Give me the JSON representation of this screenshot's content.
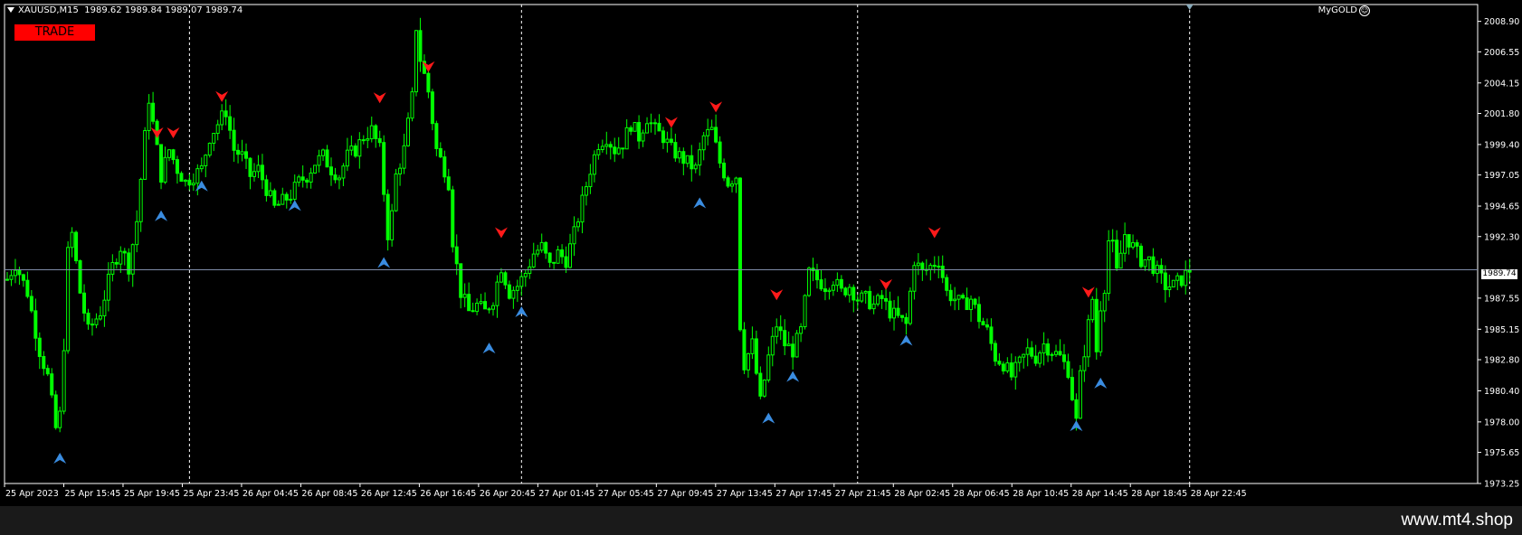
{
  "header": {
    "symbol_timeframe": "XAUUSD,M15",
    "ohlc": "1989.62 1989.84 1989.07 1989.74"
  },
  "trade_button": {
    "label": "TRADE"
  },
  "ea": {
    "name": "MyGOLD",
    "icon": "smiley-icon"
  },
  "footer": {
    "site": "www.mt4.shop"
  },
  "colors": {
    "bull": "#00ff00",
    "bear": "#00ff00",
    "sell_arrow": "#ff1a1a",
    "buy_arrow": "#3a8ce0",
    "grid": "#ffffff",
    "bid_line": "#7f8ca8",
    "background": "#000000"
  },
  "chart_data": {
    "type": "candlestick",
    "symbol": "XAUUSD",
    "timeframe": "M15",
    "current_price": "1989.74",
    "ylim": [
      1973.25,
      2010.2
    ],
    "price_ticks": [
      "2008.90",
      "2006.55",
      "2004.15",
      "2001.80",
      "1999.40",
      "1997.05",
      "1994.65",
      "1992.30",
      "1987.55",
      "1985.15",
      "1982.80",
      "1980.40",
      "1978.00",
      "1975.65",
      "1973.25"
    ],
    "time_ticks": [
      "25 Apr 2023",
      "25 Apr 15:45",
      "25 Apr 19:45",
      "25 Apr 23:45",
      "26 Apr 04:45",
      "26 Apr 08:45",
      "26 Apr 12:45",
      "26 Apr 16:45",
      "26 Apr 20:45",
      "27 Apr 01:45",
      "27 Apr 05:45",
      "27 Apr 09:45",
      "27 Apr 13:45",
      "27 Apr 17:45",
      "27 Apr 21:45",
      "28 Apr 02:45",
      "28 Apr 06:45",
      "28 Apr 10:45",
      "28 Apr 14:45",
      "28 Apr 18:45",
      "28 Apr 22:45"
    ],
    "day_separator_bars": [
      45,
      127,
      210,
      292
    ],
    "bar_count": 292,
    "close_path": [
      [
        0,
        1989.0
      ],
      [
        2,
        1990.2
      ],
      [
        5,
        1988.0
      ],
      [
        8,
        1983.5
      ],
      [
        10,
        1981.5
      ],
      [
        12,
        1977.5
      ],
      [
        13,
        1978.5
      ],
      [
        14,
        1984.0
      ],
      [
        15,
        1991.0
      ],
      [
        16,
        1992.5
      ],
      [
        18,
        1988.0
      ],
      [
        20,
        1985.0
      ],
      [
        23,
        1986.5
      ],
      [
        26,
        1990.0
      ],
      [
        28,
        1991.5
      ],
      [
        30,
        1990.0
      ],
      [
        32,
        1993.5
      ],
      [
        34,
        2000.0
      ],
      [
        35,
        2003.0
      ],
      [
        36,
        2001.0
      ],
      [
        38,
        1997.0
      ],
      [
        40,
        1999.0
      ],
      [
        42,
        1997.5
      ],
      [
        44,
        1996.5
      ],
      [
        46,
        1997.0
      ],
      [
        48,
        1997.5
      ],
      [
        50,
        2000.0
      ],
      [
        52,
        2001.0
      ],
      [
        54,
        2002.0
      ],
      [
        56,
        1999.0
      ],
      [
        58,
        1998.5
      ],
      [
        60,
        1997.0
      ],
      [
        62,
        1997.5
      ],
      [
        64,
        1996.0
      ],
      [
        66,
        1994.5
      ],
      [
        68,
        1995.0
      ],
      [
        70,
        1995.5
      ],
      [
        72,
        1996.5
      ],
      [
        74,
        1997.0
      ],
      [
        76,
        1998.0
      ],
      [
        78,
        1998.5
      ],
      [
        80,
        1997.5
      ],
      [
        82,
        1997.0
      ],
      [
        84,
        1998.5
      ],
      [
        86,
        1999.0
      ],
      [
        88,
        2000.0
      ],
      [
        90,
        2000.5
      ],
      [
        92,
        1999.0
      ],
      [
        94,
        1992.5
      ],
      [
        95,
        1994.0
      ],
      [
        96,
        1997.0
      ],
      [
        98,
        1999.0
      ],
      [
        100,
        2003.0
      ],
      [
        101,
        2008.5
      ],
      [
        102,
        2006.0
      ],
      [
        104,
        2003.5
      ],
      [
        106,
        1999.0
      ],
      [
        108,
        1997.5
      ],
      [
        109,
        1996.5
      ],
      [
        110,
        1992.0
      ],
      [
        112,
        1988.0
      ],
      [
        114,
        1986.5
      ],
      [
        116,
        1987.0
      ],
      [
        118,
        1986.5
      ],
      [
        120,
        1987.5
      ],
      [
        122,
        1990.0
      ],
      [
        124,
        1988.0
      ],
      [
        126,
        1988.5
      ],
      [
        128,
        1989.5
      ],
      [
        130,
        1991.0
      ],
      [
        132,
        1991.5
      ],
      [
        134,
        1990.0
      ],
      [
        136,
        1991.0
      ],
      [
        138,
        1990.5
      ],
      [
        140,
        1992.5
      ],
      [
        142,
        1995.0
      ],
      [
        144,
        1997.5
      ],
      [
        146,
        1999.5
      ],
      [
        148,
        2000.0
      ],
      [
        150,
        1999.0
      ],
      [
        152,
        1999.5
      ],
      [
        154,
        2001.0
      ],
      [
        156,
        2000.0
      ],
      [
        158,
        2001.5
      ],
      [
        160,
        2000.5
      ],
      [
        162,
        2000.0
      ],
      [
        164,
        1999.0
      ],
      [
        166,
        1998.5
      ],
      [
        168,
        1998.0
      ],
      [
        170,
        1997.5
      ],
      [
        172,
        2000.0
      ],
      [
        174,
        2000.5
      ],
      [
        176,
        1998.0
      ],
      [
        178,
        1996.5
      ],
      [
        180,
        1997.0
      ],
      [
        181,
        1985.5
      ],
      [
        182,
        1982.5
      ],
      [
        184,
        1984.0
      ],
      [
        186,
        1979.5
      ],
      [
        188,
        1983.0
      ],
      [
        190,
        1985.5
      ],
      [
        192,
        1984.0
      ],
      [
        194,
        1983.5
      ],
      [
        196,
        1985.0
      ],
      [
        198,
        1989.5
      ],
      [
        200,
        1989.0
      ],
      [
        202,
        1988.5
      ],
      [
        204,
        1989.0
      ],
      [
        206,
        1988.0
      ],
      [
        208,
        1988.5
      ],
      [
        210,
        1987.5
      ],
      [
        212,
        1987.5
      ],
      [
        214,
        1987.0
      ],
      [
        216,
        1987.5
      ],
      [
        218,
        1986.5
      ],
      [
        220,
        1986.0
      ],
      [
        222,
        1985.5
      ],
      [
        224,
        1990.5
      ],
      [
        226,
        1989.5
      ],
      [
        228,
        1990.0
      ],
      [
        230,
        1990.5
      ],
      [
        232,
        1988.0
      ],
      [
        234,
        1987.5
      ],
      [
        236,
        1987.0
      ],
      [
        238,
        1987.5
      ],
      [
        240,
        1986.0
      ],
      [
        242,
        1985.0
      ],
      [
        244,
        1983.0
      ],
      [
        246,
        1982.5
      ],
      [
        248,
        1981.5
      ],
      [
        250,
        1982.5
      ],
      [
        252,
        1983.5
      ],
      [
        254,
        1983.0
      ],
      [
        256,
        1984.0
      ],
      [
        258,
        1983.5
      ],
      [
        260,
        1983.0
      ],
      [
        262,
        1982.0
      ],
      [
        264,
        1978.0
      ],
      [
        265,
        1981.5
      ],
      [
        266,
        1983.5
      ],
      [
        268,
        1987.5
      ],
      [
        269,
        1983.5
      ],
      [
        270,
        1987.0
      ],
      [
        271,
        1988.5
      ],
      [
        272,
        1992.0
      ],
      [
        273,
        1991.5
      ],
      [
        274,
        1989.5
      ],
      [
        276,
        1992.5
      ],
      [
        278,
        1991.5
      ],
      [
        280,
        1990.5
      ],
      [
        282,
        1990.5
      ],
      [
        284,
        1989.5
      ],
      [
        286,
        1988.5
      ],
      [
        288,
        1988.5
      ],
      [
        290,
        1989.0
      ],
      [
        292,
        1989.74
      ]
    ],
    "sell_signals": [
      {
        "bar": 37,
        "price": 2000.3
      },
      {
        "bar": 41,
        "price": 2000.3
      },
      {
        "bar": 53,
        "price": 2003.1
      },
      {
        "bar": 92,
        "price": 2003.0
      },
      {
        "bar": 104,
        "price": 2005.4
      },
      {
        "bar": 122,
        "price": 1992.6
      },
      {
        "bar": 164,
        "price": 2001.1
      },
      {
        "bar": 175,
        "price": 2002.3
      },
      {
        "bar": 190,
        "price": 1987.8
      },
      {
        "bar": 217,
        "price": 1988.6
      },
      {
        "bar": 229,
        "price": 1992.6
      },
      {
        "bar": 267,
        "price": 1988.0
      }
    ],
    "buy_signals": [
      {
        "bar": 13,
        "price": 1975.2
      },
      {
        "bar": 38,
        "price": 1993.9
      },
      {
        "bar": 48,
        "price": 1996.2
      },
      {
        "bar": 71,
        "price": 1994.7
      },
      {
        "bar": 93,
        "price": 1990.3
      },
      {
        "bar": 119,
        "price": 1983.7
      },
      {
        "bar": 127,
        "price": 1986.5
      },
      {
        "bar": 171,
        "price": 1994.9
      },
      {
        "bar": 188,
        "price": 1978.3
      },
      {
        "bar": 194,
        "price": 1981.5
      },
      {
        "bar": 222,
        "price": 1984.3
      },
      {
        "bar": 264,
        "price": 1977.7
      },
      {
        "bar": 270,
        "price": 1981.0
      }
    ]
  }
}
